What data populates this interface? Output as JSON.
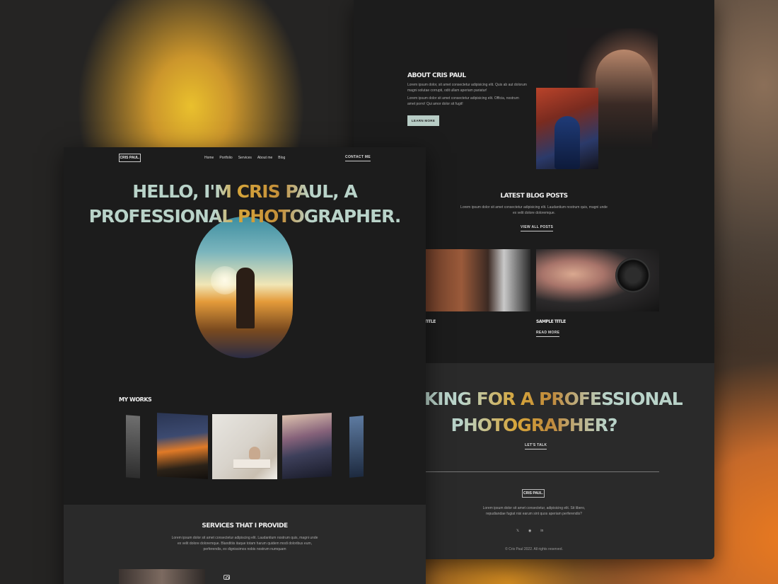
{
  "colors": {
    "accent_mint": "#b8cdc6",
    "accent_gold": "#d6a53a",
    "page_bg": "#1c1c1c",
    "band_bg": "#2a2a2a"
  },
  "nav": {
    "logo": "CRIS PAUL.",
    "links": [
      "Home",
      "Portfolio",
      "Services",
      "About me",
      "Blog"
    ],
    "contact": "CONTACT ME"
  },
  "hero": {
    "line1": "HELLO, I'M CRIS PAUL, A",
    "line2": "PROFESSIONAL PHOTOGRAPHER."
  },
  "works": {
    "title": "MY WORKS"
  },
  "services": {
    "title": "SERVICES THAT I PROVIDE",
    "text": "Lorem ipsum dolor sit amet consectetur adipiscing elit. Laudantium nostrum quis, magni unde ex velit dolore doloremque. Blanditiis itaque totam harum quidem modi doloribus eum, perferendis, ex dignissimos nobis nostrum numquam",
    "icon": "camera-icon"
  },
  "about": {
    "title": "ABOUT CRIS PAUL",
    "p1": "Lorem ipsum dolor, sit amet consectetur adipisicing elit. Quis ab aut dolorum magni solutae corrupti, odit ullam aperiam pariatur!",
    "p2": "Lorem ipsum dolor sit amet consectetur adipisicing elit. Officia, nostrum amet porro! Qui amor dolor sit fugit!",
    "button": "LEARN MORE"
  },
  "blog": {
    "title": "LATEST BLOG POSTS",
    "text": "Lorem ipsum dolor sit amet consectetur adipisicing elit. Laudantium nostrum quis, magni unde ex velit dolore doloremque.",
    "view_all": "VIEW ALL POSTS",
    "post1_title": "SAMPLE TITLE",
    "post2_title": "SAMPLE TITLE",
    "read_more": "READ MORE"
  },
  "cta": {
    "line1": "LOOKING FOR A PROFESSIONAL",
    "line2": "PHOTOGRAPHER?",
    "button": "LET'S TALK"
  },
  "footer": {
    "logo": "CRIS PAUL.",
    "text": "Lorem ipsum dolor sit amet consectetur, adipisicing elit. Sit libero, repudiandae fugiat nisi earum sint quos aperiam perferendis?",
    "socials": [
      "twitter-icon",
      "pinterest-icon",
      "linkedin-icon"
    ],
    "copyright": "© Cris Paul 2022. All rights reserved."
  }
}
